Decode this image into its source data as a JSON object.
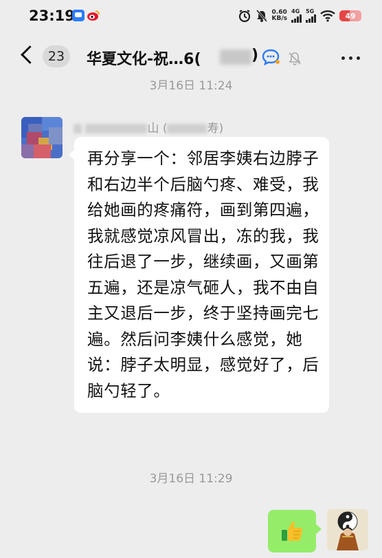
{
  "status_bar": {
    "time": "23:19",
    "net_speed_value": "0.60",
    "net_speed_unit": "KB/s",
    "signal_1_label": "4G",
    "signal_2_label": "5G",
    "battery": "49"
  },
  "header": {
    "unread_count": "23",
    "title": "华夏文化-祝…6(",
    "title_suffix": ")"
  },
  "messages": {
    "top_timestamp": "3月16日 11:24",
    "incoming": {
      "sender_name_visible": "山",
      "sender_name_suffix": "寿)",
      "text": "再分享一个：邻居李姨右边脖子和右边半个后脑勺疼、难受，我给她画的疼痛符，画到第四遍，我就感觉凉风冒出，冻的我，我往后退了一步，继续画，又画第五遍，还是凉气砸人，我不由自主又退后一步，终于坚持画完七遍。然后问李姨什么感觉，她说：脖子太明显，感觉好了，后脑勺轻了。"
    },
    "second_timestamp": "3月16日 11:29",
    "outgoing": {
      "content": "thumbs-up-emoji"
    }
  },
  "colors": {
    "background": "#ededed",
    "incoming_bubble": "#ffffff",
    "outgoing_bubble": "#95ec69",
    "timestamp": "#999999"
  }
}
